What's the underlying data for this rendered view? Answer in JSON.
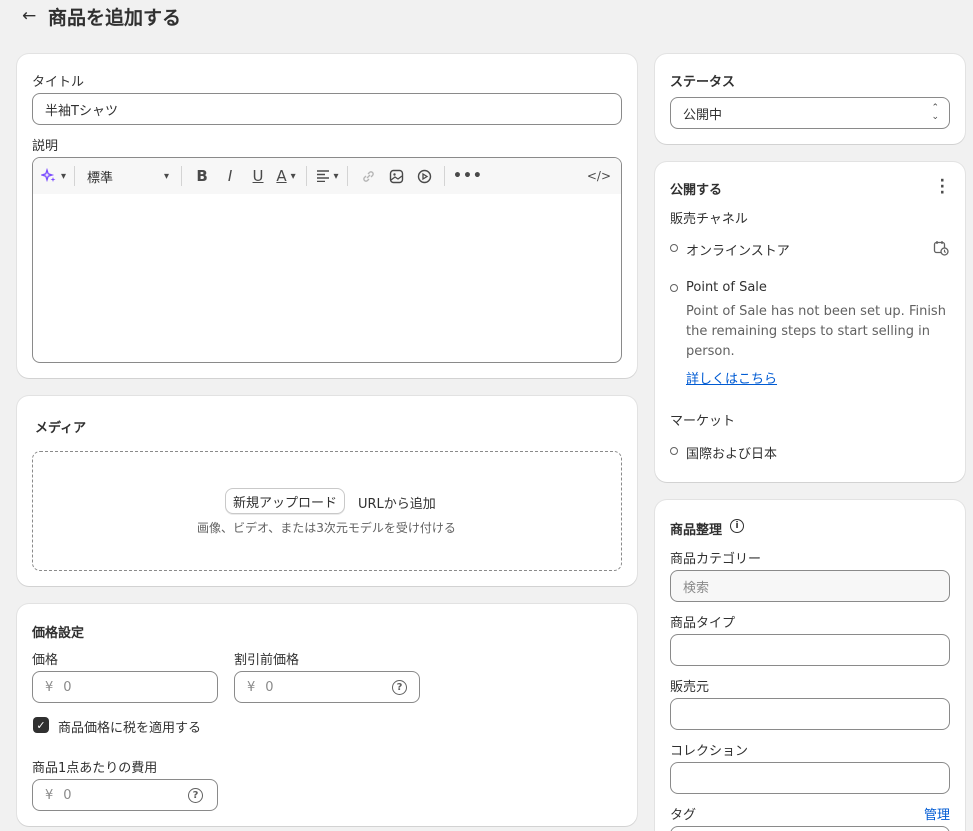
{
  "header": {
    "back_icon": "arrow-left-icon",
    "title": "商品を追加する"
  },
  "main": {
    "title_label": "タイトル",
    "title_value": "半袖Tシャツ",
    "description_label": "説明",
    "editor": {
      "format_select": "標準",
      "icons": [
        "sparkle-icon",
        "bold-icon",
        "italic-icon",
        "underline-icon",
        "text-color-icon",
        "align-icon",
        "link-icon",
        "image-icon",
        "video-icon",
        "more-icon",
        "code-icon"
      ]
    },
    "media": {
      "title": "メディア",
      "upload_button": "新規アップロード",
      "url_add": "URLから追加",
      "hint": "画像、ビデオ、または3次元モデルを受け付ける"
    },
    "pricing": {
      "title": "価格設定",
      "price_label": "価格",
      "price_currency": "¥",
      "price_value": "0",
      "compare_label": "割引前価格",
      "compare_currency": "¥",
      "compare_value": "0",
      "tax_label": "商品価格に税を適用する",
      "cost_label": "商品1点あたりの費用",
      "cost_currency": "¥",
      "cost_value": "0"
    }
  },
  "sidebar": {
    "status": {
      "title": "ステータス",
      "value": "公開中"
    },
    "publishing": {
      "title": "公開する",
      "channels_label": "販売チャネル",
      "online_store": "オンラインストア",
      "pos": "Point of Sale",
      "pos_desc_1": "Point of Sale has not been set up. Finish",
      "pos_desc_2": "the remaining steps to start selling in",
      "pos_desc_3": "person.",
      "pos_link": "詳しくはこちら",
      "markets_label": "マーケット",
      "market_value": "国際および日本"
    },
    "organization": {
      "title": "商品整理",
      "category_label": "商品カテゴリー",
      "category_placeholder": "検索",
      "type_label": "商品タイプ",
      "vendor_label": "販売元",
      "collection_label": "コレクション",
      "tags_label": "タグ",
      "tags_manage": "管理"
    }
  }
}
